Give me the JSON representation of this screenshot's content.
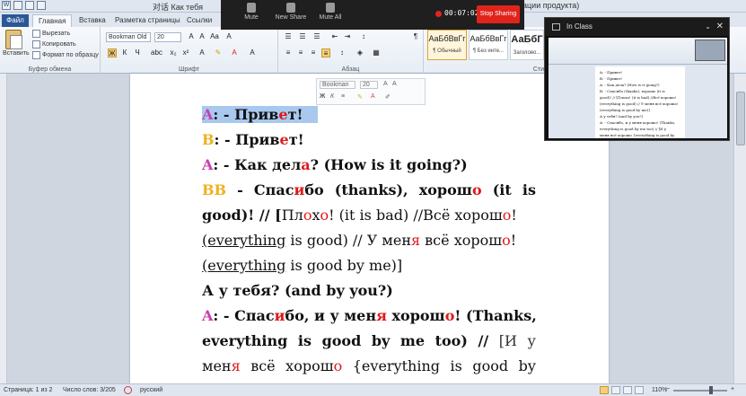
{
  "titlebar": {
    "title_left": "对话 Как тебя",
    "title_right": "ации продукта)"
  },
  "tabs": {
    "file": "Файл",
    "home": "Главная",
    "insert": "Вставка",
    "layout": "Разметка страницы",
    "links": "Ссылки"
  },
  "ribbon": {
    "paste": "Вставить",
    "cut": "Вырезать",
    "copy": "Копировать",
    "format_painter": "Формат по образцу",
    "clipboard_label": "Буфер обмена",
    "font_name": "Bookman Old",
    "font_size": "20",
    "font_label": "Шрифт",
    "paragraph_label": "Абзац",
    "styles_label": "Сти",
    "styles": [
      {
        "sample": "АаБбВвГг",
        "name": "¶ Обычный",
        "selected": true
      },
      {
        "sample": "АаБбВвГг",
        "name": "¶ Без инте...",
        "selected": false
      },
      {
        "sample": "АаБбГ",
        "name": "Заголово...",
        "selected": false
      }
    ]
  },
  "mini_toolbar": {
    "font_name": "Bookman",
    "font_size": "20"
  },
  "document": {
    "l1": {
      "who": "A",
      "text": ": - Прив",
      "red": "е",
      "tail": "т!"
    },
    "l2": {
      "who": "B",
      "text": ": - Прив",
      "red": "е",
      "tail": "т!"
    },
    "l3": {
      "who": "A",
      "text": ": - Как дел",
      "red": "а",
      "tail": "? (How is it going?)"
    },
    "l4": {
      "who": "B",
      "text": ":",
      "w1": "-",
      "w2a": "Спас",
      "w2r": "и",
      "w2b": "бо",
      "w3": "(thanks),",
      "w4a": "хорош",
      "w4r": "о",
      "w5": "(it",
      "w6": "is"
    },
    "l5": {
      "a": "good)! // [",
      "b": "Пл",
      "r1": "о",
      "c": "х",
      "r2": "о",
      "d": "! (it is bad) //Всё хорош",
      "r3": "о",
      "e": "!"
    },
    "l6": {
      "a": "(everything",
      "b": " is good) // У мен",
      "r": "я",
      "c": " всё хорош",
      "r2": "о",
      "d": "!"
    },
    "l7": {
      "a": "(everything",
      "b": " is good by me)]"
    },
    "l8": {
      "text": "А у тебя? (and by you?)"
    },
    "l9": {
      "who": "A",
      "a": ": - Спас",
      "r1": "и",
      "b": "бо, и у мен",
      "r2": "я",
      "c": " хорош",
      "r3": "о",
      "d": "! (Thanks,"
    },
    "l10": {
      "w1": "everything",
      "w2": "is",
      "w3": "good",
      "w4": "by",
      "w5": "me",
      "w6": "too)",
      "w7": "//",
      "w8": "[И",
      "w9": "у"
    },
    "l11": {
      "a": "мен",
      "r1": "я",
      "w2": "всё",
      "w3a": "хорош",
      "w3r": "о",
      "w4": "{everything",
      "w5": "is",
      "w6": "good",
      "w7": "by"
    }
  },
  "zoom_bar": {
    "mute": "Mute",
    "new_share": "New Share",
    "mute_all": "Mute All",
    "timer": "00:07:02",
    "stop": "Stop Sharing"
  },
  "in_class": {
    "title": "In Class",
    "mini_lines": [
      "A: - Привет!",
      "B: - Привет!",
      "A: - Как дела? (How is it going?)",
      "B: - Спасибо (thanks), хорошо (it is",
      "good)! // [Плохо! (it is bad) //Всё хорошо!",
      "(everything is good) // У меня всё хорошо!",
      "(everything is good by me)]",
      "А у тебя? (and by you?)",
      "A: - Спасибо, и у меня хорошо! (Thanks,",
      "everything is good by me too) // [И у",
      "меня всё хорошо {everything is good by"
    ]
  },
  "statusbar": {
    "page": "Страница: 1 из 2",
    "words": "Число слов: 3/205",
    "lang": "русский",
    "zoom": "110%"
  },
  "colors": {
    "speaker_a": "#c83fae",
    "speaker_b": "#f0b020",
    "stress": "#e01a1a",
    "stop_button": "#e0241c",
    "file_tab": "#2b5797"
  }
}
